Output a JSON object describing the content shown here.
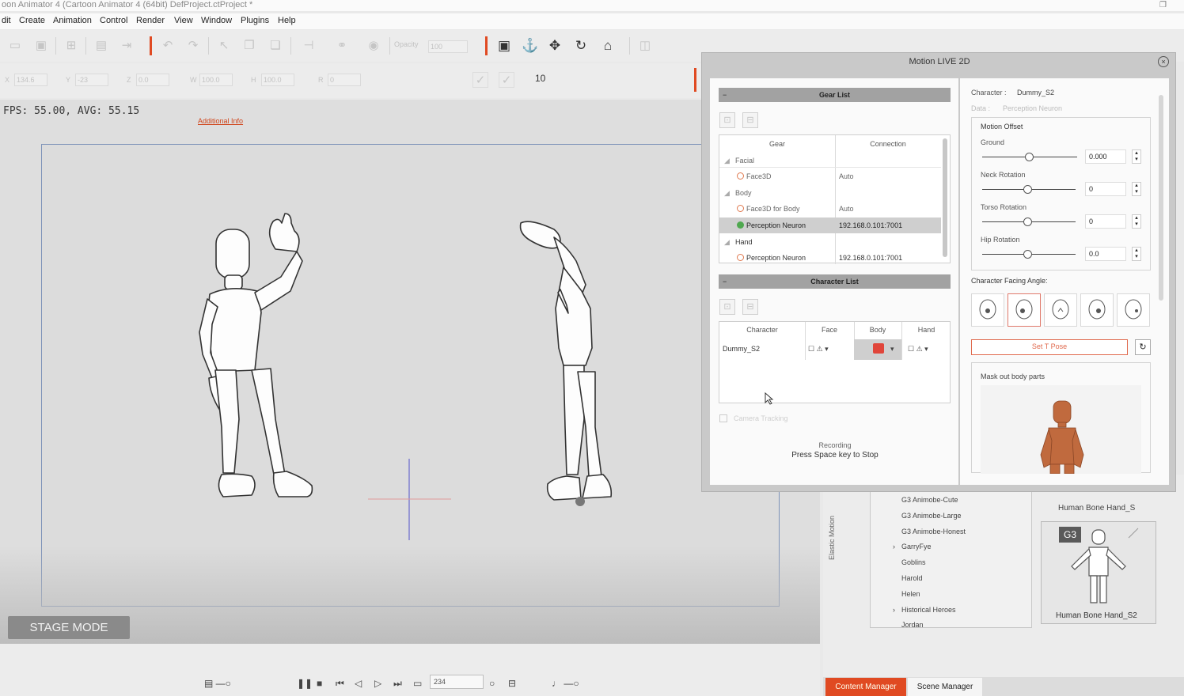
{
  "window": {
    "title": "oon Animator 4  (Cartoon Animator 4 (64bit)   DefProject.ctProject *"
  },
  "menu": [
    "dit",
    "Create",
    "Animation",
    "Control",
    "Render",
    "View",
    "Window",
    "Plugins",
    "Help"
  ],
  "toolbar": {
    "opacity_label": "Opacity",
    "opacity_value": "100",
    "x_label": "X",
    "x_value": "134.6",
    "y_label": "Y",
    "y_value": "-23",
    "z_label": "Z",
    "z_value": "0.0",
    "w_label": "W",
    "w_value": "100.0",
    "h_label": "H",
    "h_value": "100.0",
    "r_label": "R",
    "r_value": "0",
    "flip_label": "10"
  },
  "viewport": {
    "fps_text": "FPS: 55.00, AVG: 55.15",
    "stage_mode_label": "STAGE MODE"
  },
  "timeline": {
    "frame_value": "234"
  },
  "library": {
    "side_tab": "Elastic Motion",
    "tree_items": [
      "G3 Animobe-Cute",
      "G3 Animobe-Large",
      "G3 Animobe-Honest",
      "GarryFye",
      "Goblins",
      "Harold",
      "Helen",
      "Historical Heroes",
      "Jordan"
    ],
    "thumb1_label": "Human Bone Hand_S",
    "thumb2_badge": "G3",
    "thumb2_label": "Human Bone Hand_S2"
  },
  "bottom_tabs": {
    "content": "Content Manager",
    "scene": "Scene Manager"
  },
  "dialog": {
    "title": "Motion LIVE 2D",
    "gear_list": {
      "header": "Gear List",
      "additional_info": "Additional Info",
      "columns": [
        "Gear",
        "Connection"
      ],
      "rows": [
        {
          "gear": "Facial",
          "connection": "",
          "type": "group"
        },
        {
          "gear": "Face3D",
          "connection": "Auto",
          "type": "item",
          "status": "off"
        },
        {
          "gear": "Body",
          "connection": "",
          "type": "group"
        },
        {
          "gear": "Face3D for Body",
          "connection": "Auto",
          "type": "item",
          "status": "off"
        },
        {
          "gear": "Perception Neuron",
          "connection": "192.168.0.101:7001",
          "type": "item",
          "status": "on",
          "selected": true
        },
        {
          "gear": "Hand",
          "connection": "",
          "type": "group"
        },
        {
          "gear": "Perception Neuron",
          "connection": "192.168.0.101:7001",
          "type": "item",
          "status": "off"
        }
      ]
    },
    "character_list": {
      "header": "Character List",
      "columns": [
        "Character",
        "Face",
        "Body",
        "Hand"
      ],
      "rows": [
        {
          "character": "Dummy_S2"
        }
      ]
    },
    "camera_tracking": "Camera Tracking",
    "recording_status": "Recording",
    "recording_hint": "Press Space key to Stop",
    "character_label": "Character :",
    "character_value": "Dummy_S2",
    "data_label": "Data :",
    "data_value": "Perception Neuron",
    "motion_offset": {
      "title": "Motion Offset",
      "sliders": [
        {
          "label": "Ground",
          "value": "0.000",
          "level": 0.5
        },
        {
          "label": "Neck Rotation",
          "value": "0",
          "level": 0.5
        },
        {
          "label": "Torso Rotation",
          "value": "0",
          "level": 0.5
        },
        {
          "label": "Hip Rotation",
          "value": "0.0",
          "level": 0.5
        }
      ]
    },
    "facing_label": "Character Facing Angle:",
    "tpose_label": "Set T Pose",
    "mask_label": "Mask out body parts"
  },
  "colors": {
    "accent": "#e04a22",
    "selected_row": "#cfcfcf",
    "connected": "#4fa84f"
  }
}
